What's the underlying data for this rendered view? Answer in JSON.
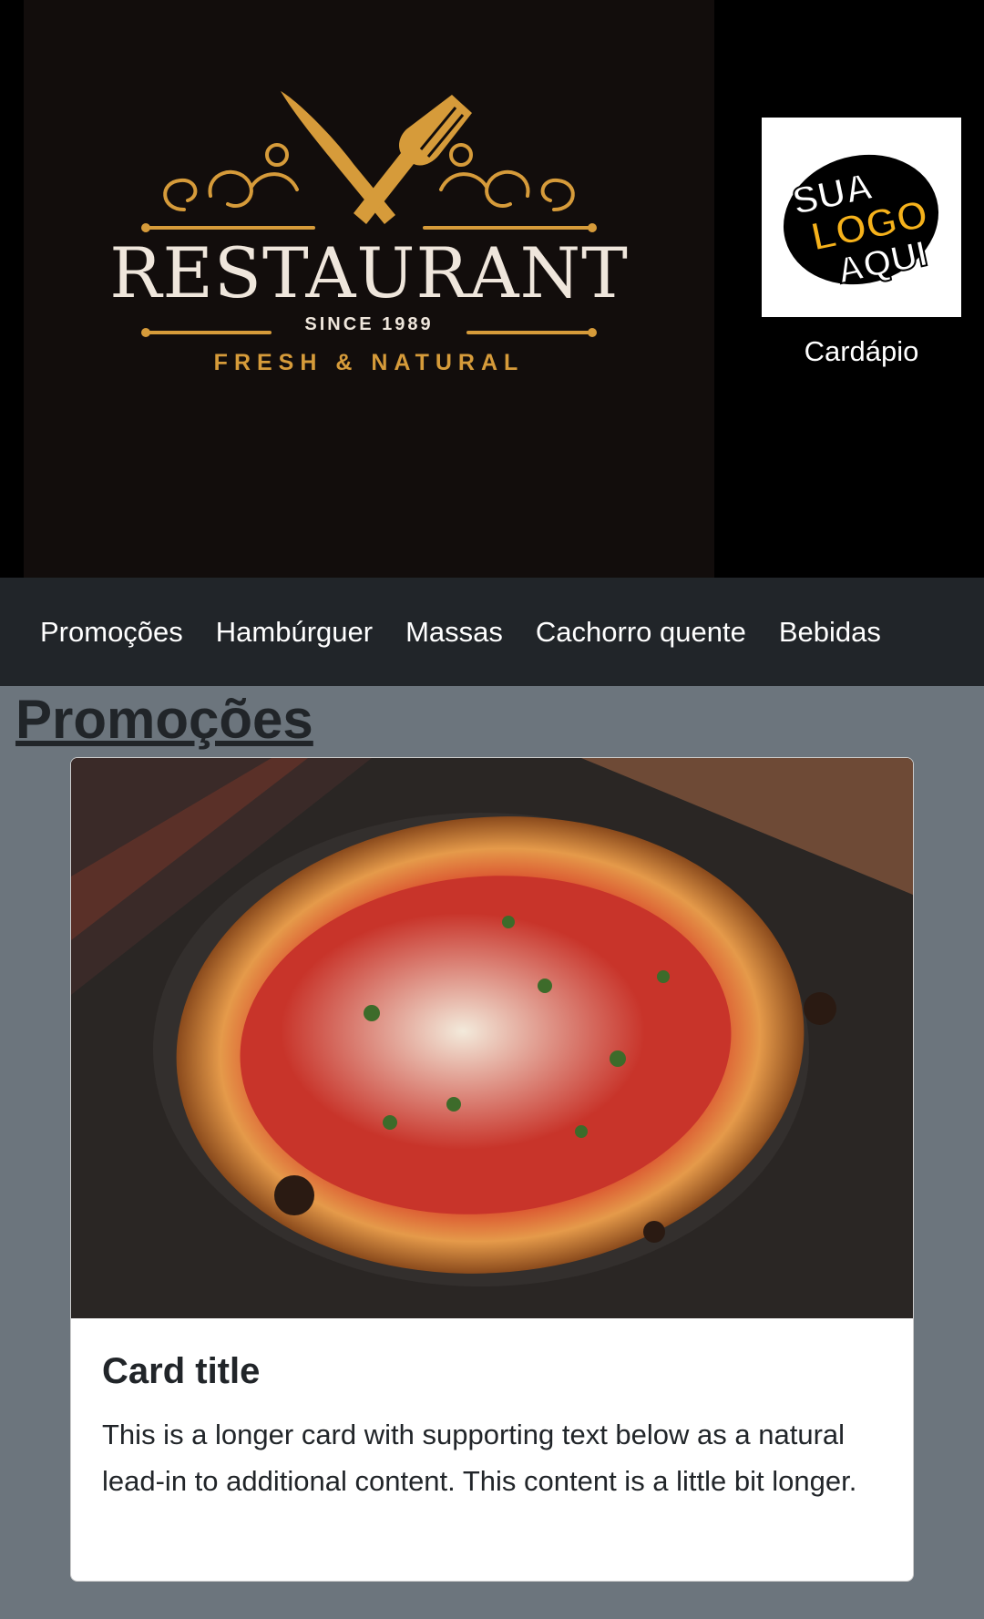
{
  "header": {
    "banner": {
      "title": "RESTAURANT",
      "since": "SINCE 1989",
      "tagline": "FRESH & NATURAL",
      "brand_color": "#d69b3a"
    },
    "brand": {
      "logo_text": [
        "SUA",
        "LOGO",
        "AQUI"
      ],
      "label": "Cardápio"
    }
  },
  "nav": {
    "items": [
      {
        "label": "Promoções"
      },
      {
        "label": "Hambúrguer"
      },
      {
        "label": "Massas"
      },
      {
        "label": "Cachorro quente"
      },
      {
        "label": "Bebidas"
      }
    ]
  },
  "main": {
    "section_title": "Promoções",
    "card": {
      "image": "pizza-photo",
      "title": "Card title",
      "text": "This is a longer card with supporting text below as a natural lead-in to additional content. This content is a little bit longer."
    }
  }
}
